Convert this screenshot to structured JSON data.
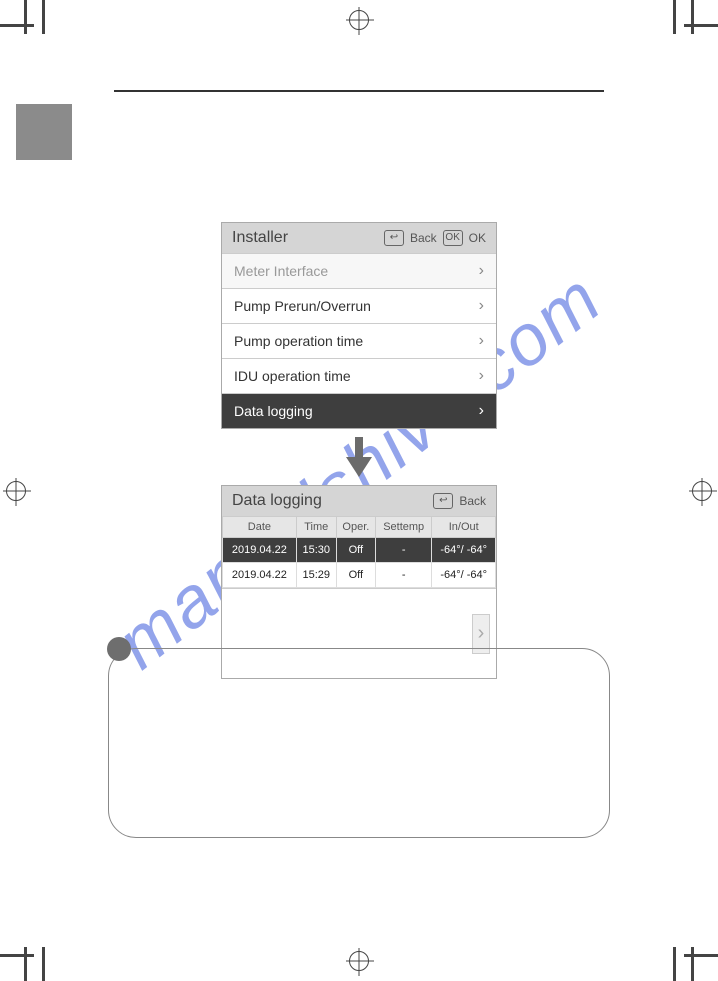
{
  "watermark": "manualshive.com",
  "installer_screen": {
    "title": "Installer",
    "back_label": "Back",
    "ok_label": "OK",
    "items": [
      {
        "label": "Meter Interface",
        "dim": true
      },
      {
        "label": "Pump Prerun/Overrun"
      },
      {
        "label": "Pump operation time"
      },
      {
        "label": "IDU operation time"
      },
      {
        "label": "Data logging",
        "selected": true
      }
    ]
  },
  "log_screen": {
    "title": "Data logging",
    "back_label": "Back",
    "columns": [
      "Date",
      "Time",
      "Oper.",
      "Settemp",
      "In/Out"
    ],
    "rows": [
      {
        "date": "2019.04.22",
        "time": "15:30",
        "oper": "Off",
        "settemp": "-",
        "inout": "-64°/ -64°",
        "selected": true
      },
      {
        "date": "2019.04.22",
        "time": "15:29",
        "oper": "Off",
        "settemp": "-",
        "inout": "-64°/ -64°"
      }
    ]
  }
}
